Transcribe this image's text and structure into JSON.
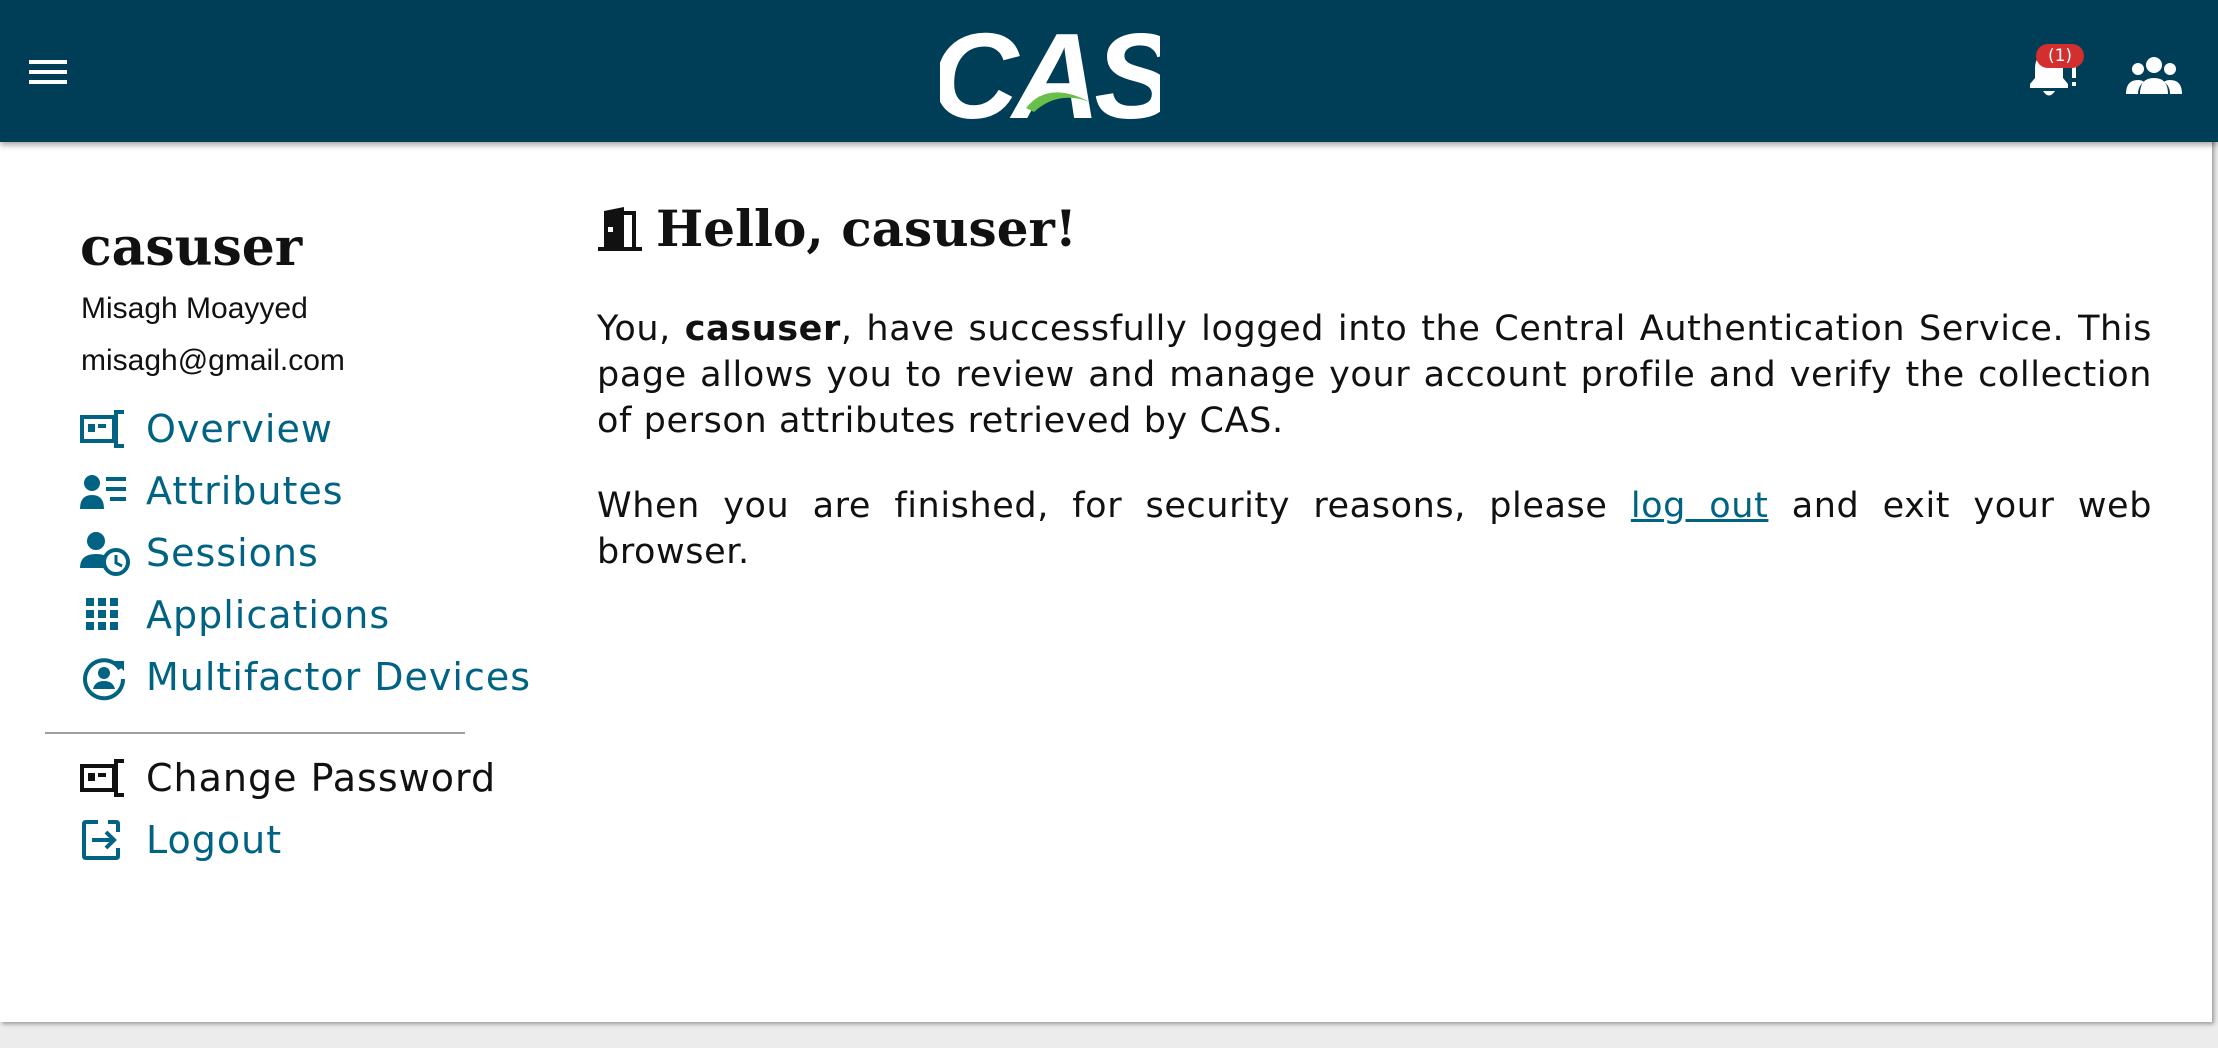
{
  "header": {
    "logo_text": "CAS",
    "notification_count": "(1)",
    "icons": [
      "menu-icon",
      "bell-icon",
      "people-icon"
    ],
    "bar_color": "#003d57"
  },
  "profile": {
    "username": "casuser",
    "full_name": "Misagh Moayyed",
    "email": "misagh@gmail.com"
  },
  "nav": {
    "overview": "Overview",
    "attributes": "Attributes",
    "sessions": "Sessions",
    "applications": "Applications",
    "mfa_devices": "Multifactor Devices",
    "change_password": "Change Password",
    "logout": "Logout"
  },
  "main": {
    "title": "Hello, casuser!",
    "intro_prefix": "You, ",
    "intro_user": "casuser",
    "intro_rest": ", have successfully logged into the Central Authentication Service. This page allows you to review and manage your account profile and verify the collection of person attributes retrieved by CAS.",
    "finish_prefix": "When you are finished, for security reasons, please ",
    "finish_link": "log out",
    "finish_suffix": " and exit your web browser."
  },
  "colors": {
    "accent": "#006383",
    "badge": "#d32f2f",
    "logo_green": "#6abf4b"
  }
}
